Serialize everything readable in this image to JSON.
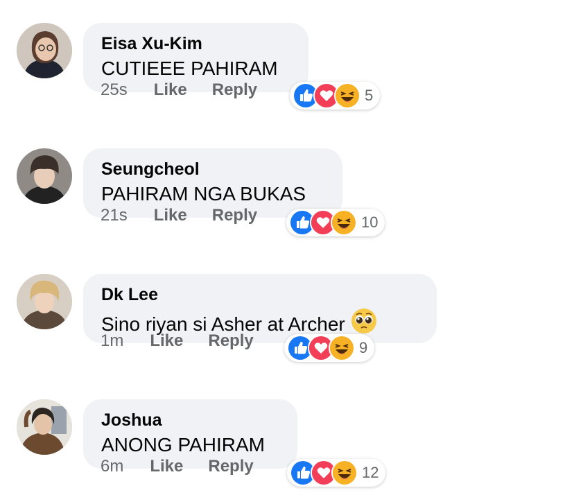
{
  "actions": {
    "like_label": "Like",
    "reply_label": "Reply"
  },
  "comments": [
    {
      "author": "Eisa Xu-Kim",
      "text": "CUTIEEE PAHIRAM",
      "time": "25s",
      "reaction_count": "5",
      "emoji": ""
    },
    {
      "author": "Seungcheol",
      "text": "PAHIRAM NGA BUKAS",
      "time": "21s",
      "reaction_count": "10",
      "emoji": ""
    },
    {
      "author": "Dk Lee",
      "text": "Sino riyan si Asher at Archer",
      "time": "1m",
      "reaction_count": "9",
      "emoji": "pleading-face-emoji"
    },
    {
      "author": "Joshua",
      "text": "ANONG PAHIRAM",
      "time": "6m",
      "reaction_count": "12",
      "emoji": ""
    }
  ],
  "colors": {
    "bubble_bg": "#f0f2f5",
    "meta_text": "#65676b",
    "like_blue": "#1877f2",
    "love_red": "#f33e58",
    "haha_yellow": "#f7b125"
  }
}
